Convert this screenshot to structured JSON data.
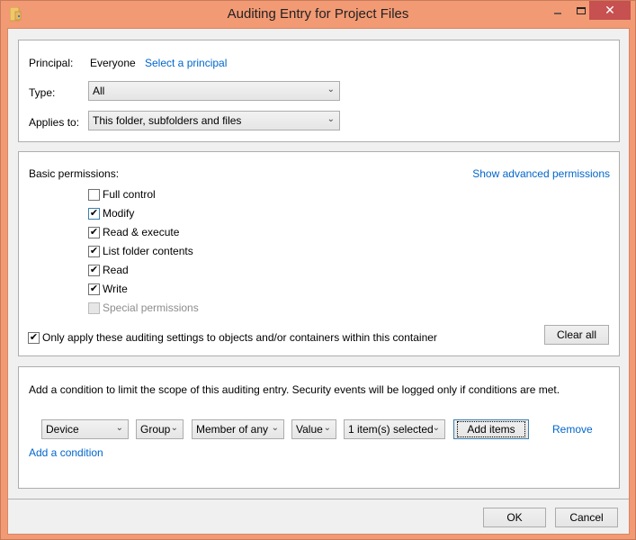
{
  "window": {
    "title": "Auditing Entry for Project Files",
    "icon": "folder-icon",
    "controls": {
      "minimize": "minimize-icon",
      "maximize": "maximize-icon",
      "close": "✕"
    }
  },
  "principal_section": {
    "principal_label": "Principal:",
    "principal_value": "Everyone",
    "select_principal_link": "Select a principal",
    "type_label": "Type:",
    "type_value": "All",
    "applies_label": "Applies to:",
    "applies_value": "This folder, subfolders and files"
  },
  "permissions_section": {
    "heading": "Basic permissions:",
    "advanced_link": "Show advanced permissions",
    "items": [
      {
        "label": "Full control",
        "checked": false,
        "disabled": false
      },
      {
        "label": "Modify",
        "checked": true,
        "disabled": false
      },
      {
        "label": "Read & execute",
        "checked": true,
        "disabled": false
      },
      {
        "label": "List folder contents",
        "checked": true,
        "disabled": false
      },
      {
        "label": "Read",
        "checked": true,
        "disabled": false
      },
      {
        "label": "Write",
        "checked": true,
        "disabled": false
      },
      {
        "label": "Special permissions",
        "checked": false,
        "disabled": true
      }
    ],
    "only_apply_label": "Only apply these auditing settings to objects and/or containers within this container",
    "only_apply_checked": true,
    "clear_all_label": "Clear all"
  },
  "condition_section": {
    "description": "Add a condition to limit the scope of this auditing entry. Security events will be logged only if conditions are met.",
    "condition": {
      "attribute_source": "Device",
      "attribute": "Group",
      "operator": "Member of any",
      "value_type": "Value",
      "value": "1 item(s) selected",
      "add_items_label": "Add items",
      "remove_label": "Remove"
    },
    "add_condition_link": "Add a condition"
  },
  "footer": {
    "ok_label": "OK",
    "cancel_label": "Cancel"
  },
  "check_glyph": "✔",
  "chevron_glyph": "⌄"
}
